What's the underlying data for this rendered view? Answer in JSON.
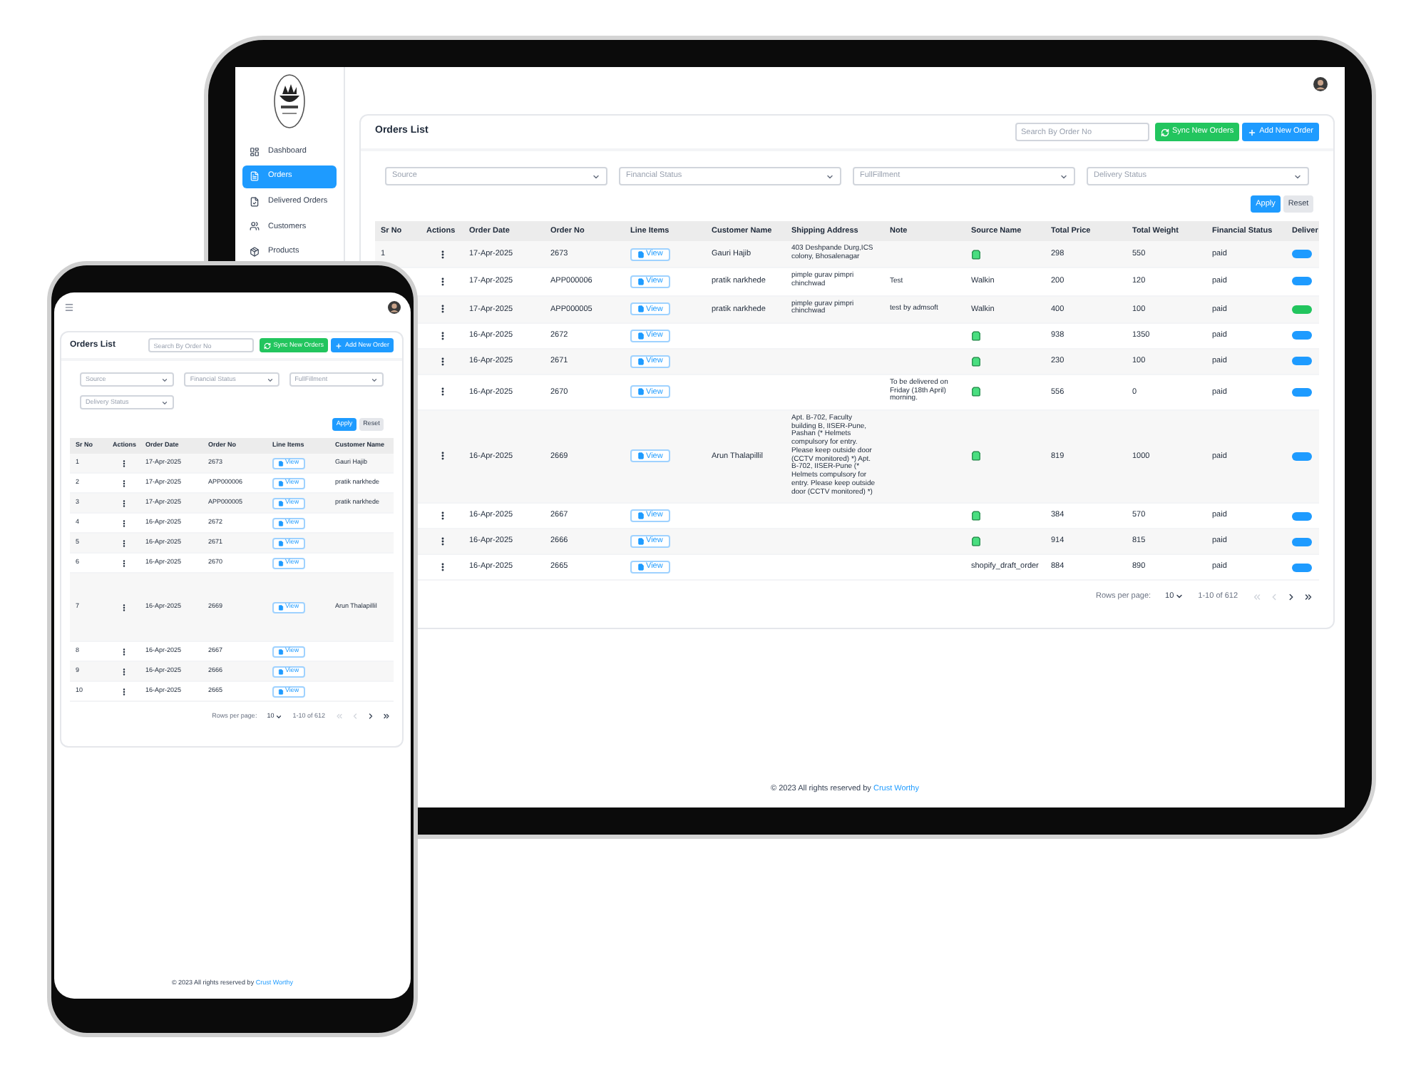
{
  "tablet": {
    "sidebar": {
      "items": [
        {
          "kind": "dashboard",
          "label": "Dashboard",
          "selected": false
        },
        {
          "kind": "orders",
          "label": "Orders",
          "selected": true
        },
        {
          "kind": "delivered",
          "label": "Delivered Orders",
          "selected": false
        },
        {
          "kind": "customers",
          "label": "Customers",
          "selected": false
        },
        {
          "kind": "products",
          "label": "Products",
          "selected": false
        }
      ]
    },
    "page_title": "Orders List",
    "search": {
      "placeholder": "Search By Order No"
    },
    "buttons": [
      {
        "kind": "sync",
        "label": "Sync New Orders"
      },
      {
        "kind": "add",
        "label": "Add New Order"
      }
    ],
    "filters": [
      "Source",
      "Financial Status",
      "FullFillment",
      "Delivery Status"
    ],
    "filter_buttons": [
      {
        "kind": "apply",
        "label": "Apply"
      },
      {
        "kind": "reset",
        "label": "Reset"
      }
    ],
    "table": {
      "columns": [
        "Sr No",
        "Actions",
        "Order Date",
        "Order No",
        "Line Items",
        "Customer Name",
        "Shipping Address",
        "Note",
        "Source Name",
        "Total Price",
        "Total Weight",
        "Financial Status",
        "Deliver"
      ],
      "rows": [
        {
          "sr_no": "1",
          "order_date": "17-Apr-2025",
          "order_no": "2673",
          "line_items": "View",
          "customer_name": "Gauri Hajib",
          "shipping_address": "403 Deshpande Durg,ICS colony, Bhosalenagar",
          "source": {
            "kind": "icon"
          },
          "total_price": "298",
          "total_weight": "550",
          "financial_status": "paid",
          "color": "#1e9bff"
        },
        {
          "order_date": "17-Apr-2025",
          "order_no": "APP000006",
          "line_items": "View",
          "customer_name": "pratik narkhede",
          "shipping_address": "pimple gurav pimpri chinchwad",
          "note": "Test",
          "source": {
            "kind": "text",
            "text": "Walkin"
          },
          "total_price": "200",
          "total_weight": "120",
          "financial_status": "paid",
          "color": "#1e9bff"
        },
        {
          "order_date": "17-Apr-2025",
          "order_no": "APP000005",
          "line_items": "View",
          "customer_name": "pratik narkhede",
          "shipping_address": "pimple gurav pimpri chinchwad",
          "note": "test by admsoft",
          "source": {
            "kind": "text",
            "text": "Walkin"
          },
          "total_price": "400",
          "total_weight": "100",
          "financial_status": "paid",
          "color": "#22c55e"
        },
        {
          "order_date": "16-Apr-2025",
          "order_no": "2672",
          "line_items": "View",
          "source": {
            "kind": "icon"
          },
          "total_price": "938",
          "total_weight": "1350",
          "financial_status": "paid",
          "color": "#1e9bff"
        },
        {
          "order_date": "16-Apr-2025",
          "order_no": "2671",
          "line_items": "View",
          "source": {
            "kind": "icon"
          },
          "total_price": "230",
          "total_weight": "100",
          "financial_status": "paid",
          "color": "#1e9bff"
        },
        {
          "order_date": "16-Apr-2025",
          "order_no": "2670",
          "line_items": "View",
          "note": "To be delivered on Friday (18th April) morning.",
          "source": {
            "kind": "icon"
          },
          "total_price": "556",
          "total_weight": "0",
          "financial_status": "paid",
          "color": "#1e9bff"
        },
        {
          "order_date": "16-Apr-2025",
          "order_no": "2669",
          "line_items": "View",
          "customer_name": "Arun Thalapillil",
          "shipping_address": "Apt. B-702, Faculty building B, IISER-Pune, Pashan (* Helmets compulsory for entry. Please keep outside door (CCTV monitored) *) Apt. B-702, IISER-Pune (* Helmets compulsory for entry. Please keep outside door (CCTV monitored) *)",
          "source": {
            "kind": "icon"
          },
          "total_price": "819",
          "total_weight": "1000",
          "financial_status": "paid",
          "color": "#1e9bff"
        },
        {
          "order_date": "16-Apr-2025",
          "order_no": "2667",
          "line_items": "View",
          "source": {
            "kind": "icon"
          },
          "total_price": "384",
          "total_weight": "570",
          "financial_status": "paid",
          "color": "#1e9bff"
        },
        {
          "order_date": "16-Apr-2025",
          "order_no": "2666",
          "line_items": "View",
          "source": {
            "kind": "icon"
          },
          "total_price": "914",
          "total_weight": "815",
          "financial_status": "paid",
          "color": "#1e9bff"
        },
        {
          "order_date": "16-Apr-2025",
          "order_no": "2665",
          "line_items": "View",
          "source": {
            "kind": "text",
            "text": "shopify_draft_order"
          },
          "total_price": "884",
          "total_weight": "890",
          "financial_status": "paid",
          "color": "#1e9bff"
        }
      ]
    },
    "pagination": {
      "rows_label": "Rows per page:",
      "rows_value": "10",
      "range": "1-10 of 612",
      "nav": [
        {
          "kind": "first",
          "disabled": true
        },
        {
          "kind": "prev",
          "disabled": true
        },
        {
          "kind": "next",
          "disabled": false
        },
        {
          "kind": "last",
          "disabled": false
        }
      ]
    },
    "footer": {
      "text": "© 2023 All rights reserved by",
      "link": "Crust Worthy"
    }
  },
  "phone": {
    "page_title": "Orders List",
    "search": {
      "placeholder": "Search By Order No"
    },
    "buttons": [
      {
        "kind": "sync",
        "label": "Sync New Orders"
      },
      {
        "kind": "add",
        "label": "Add New Order"
      }
    ],
    "filters": [
      "Source",
      "Financial Status",
      "FullFillment",
      "Delivery Status"
    ],
    "filter_buttons": [
      {
        "kind": "apply",
        "label": "Apply"
      },
      {
        "kind": "reset",
        "label": "Reset"
      }
    ],
    "table": {
      "columns": [
        "Sr No",
        "Actions",
        "Order Date",
        "Order No",
        "Line Items",
        "Customer Name"
      ],
      "rows": [
        {
          "sr_no": "1",
          "order_date": "17-Apr-2025",
          "order_no": "2673",
          "line_items": "View",
          "customer_name": "Gauri Hajib"
        },
        {
          "sr_no": "2",
          "order_date": "17-Apr-2025",
          "order_no": "APP000006",
          "line_items": "View",
          "customer_name": "pratik narkhede"
        },
        {
          "sr_no": "3",
          "order_date": "17-Apr-2025",
          "order_no": "APP000005",
          "line_items": "View",
          "customer_name": "pratik narkhede"
        },
        {
          "sr_no": "4",
          "order_date": "16-Apr-2025",
          "order_no": "2672",
          "line_items": "View"
        },
        {
          "sr_no": "5",
          "order_date": "16-Apr-2025",
          "order_no": "2671",
          "line_items": "View"
        },
        {
          "sr_no": "6",
          "order_date": "16-Apr-2025",
          "order_no": "2670",
          "line_items": "View"
        },
        {
          "sr_no": "7",
          "order_date": "16-Apr-2025",
          "order_no": "2669",
          "line_items": "View",
          "customer_name": "Arun Thalapillil",
          "tall": true
        },
        {
          "sr_no": "8",
          "order_date": "16-Apr-2025",
          "order_no": "2667",
          "line_items": "View"
        },
        {
          "sr_no": "9",
          "order_date": "16-Apr-2025",
          "order_no": "2666",
          "line_items": "View"
        },
        {
          "sr_no": "10",
          "order_date": "16-Apr-2025",
          "order_no": "2665",
          "line_items": "View"
        }
      ]
    },
    "pagination": {
      "rows_label": "Rows per page:",
      "rows_value": "10",
      "range": "1-10 of 612",
      "nav": [
        {
          "kind": "first",
          "disabled": true
        },
        {
          "kind": "prev",
          "disabled": true
        },
        {
          "kind": "next",
          "disabled": false
        },
        {
          "kind": "last",
          "disabled": false
        }
      ]
    },
    "footer": {
      "text": "© 2023 All rights reserved by",
      "link": "Crust Worthy"
    }
  }
}
